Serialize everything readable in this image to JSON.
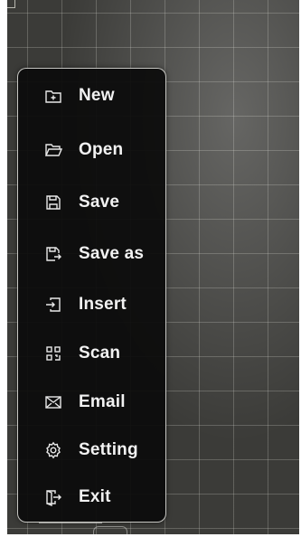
{
  "menu": {
    "items": [
      {
        "label": "New",
        "icon": "new-file-icon"
      },
      {
        "label": "Open",
        "icon": "folder-open-icon"
      },
      {
        "label": "Save",
        "icon": "floppy-disk-icon"
      },
      {
        "label": "Save as",
        "icon": "save-as-icon"
      },
      {
        "label": "Insert",
        "icon": "insert-icon"
      },
      {
        "label": "Scan",
        "icon": "scan-qr-icon"
      },
      {
        "label": "Email",
        "icon": "envelope-icon"
      },
      {
        "label": "Setting",
        "icon": "gear-icon"
      },
      {
        "label": "Exit",
        "icon": "exit-icon"
      }
    ]
  },
  "colors": {
    "menu_background": "#0c0c0c",
    "menu_text": "#f2f2f2",
    "canvas_background": "#3b3b38",
    "grid_line": "#c8c8c3"
  }
}
